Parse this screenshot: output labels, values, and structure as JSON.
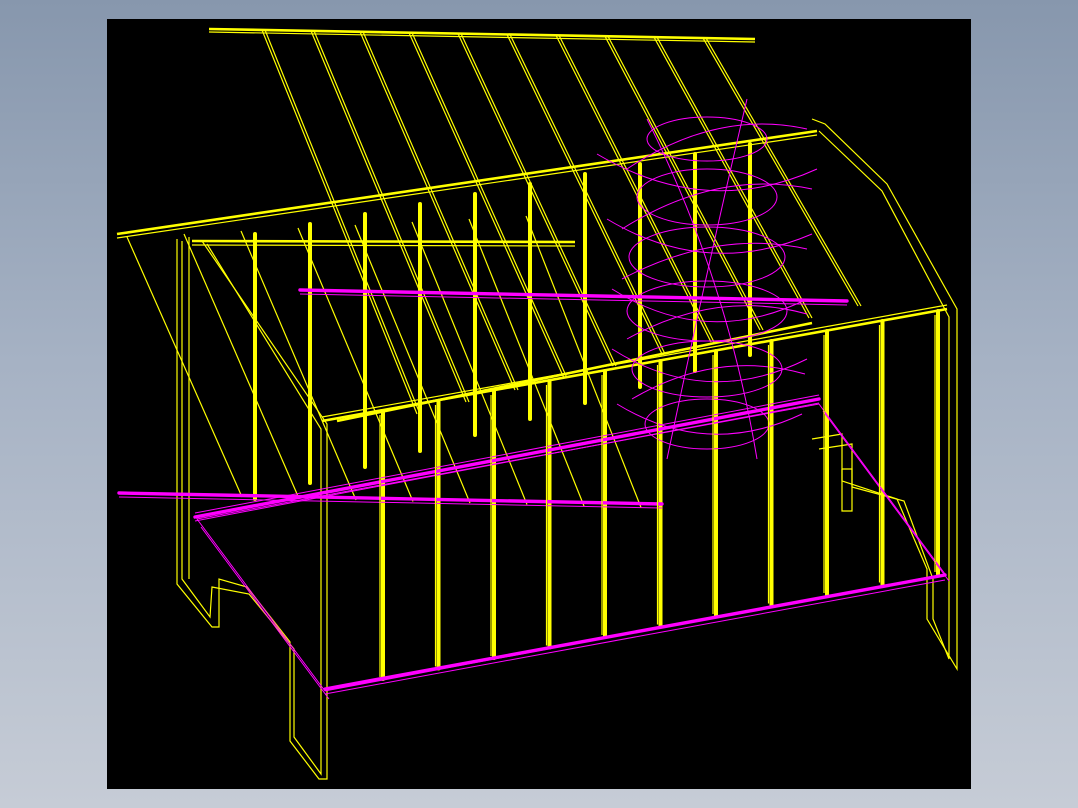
{
  "window": {
    "background_top": "#8797ad",
    "background_bottom": "#c6ccd6"
  },
  "viewport": {
    "background": "#000000",
    "colors": {
      "frame": "#ffff00",
      "shelves": "#ff00ff"
    },
    "components": [
      "top-wire-grid",
      "left-side-frame",
      "right-side-frame",
      "front-rod-rail",
      "front-vertical-rods",
      "back-vertical-rods",
      "magenta-shelf-bars",
      "base-board",
      "curve-construction-lines"
    ]
  }
}
